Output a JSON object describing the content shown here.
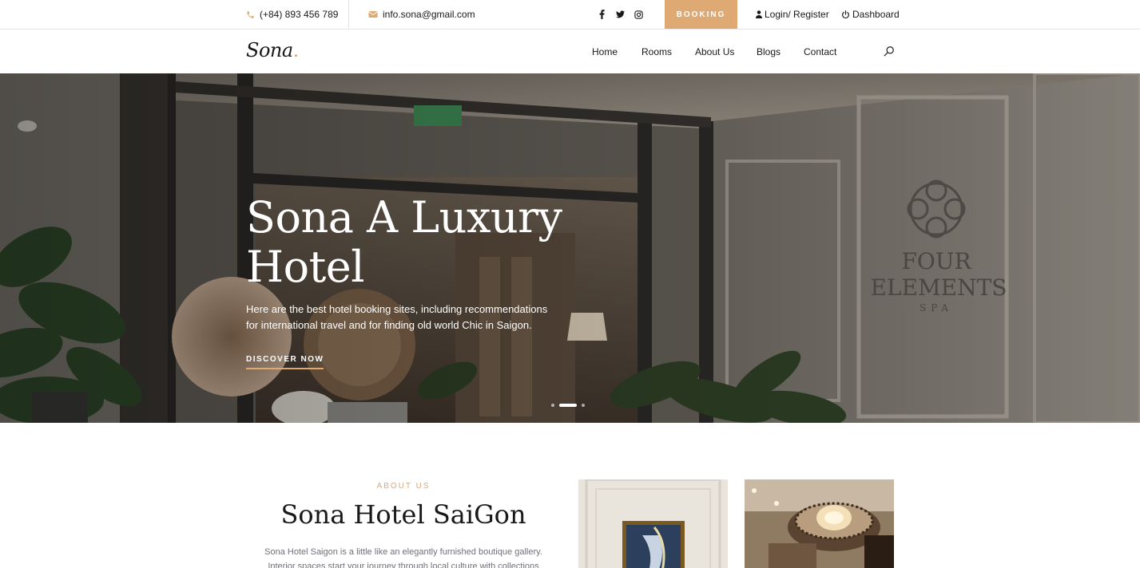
{
  "topbar": {
    "phone": "(+84) 893 456 789",
    "email": "info.sona@gmail.com",
    "social": [
      "facebook-icon",
      "twitter-icon",
      "instagram-icon"
    ],
    "booking_label": "BOOKING",
    "login_label": "Login/ Register",
    "dashboard_label": "Dashboard"
  },
  "nav": {
    "logo_text": "Sona",
    "logo_dot": ".",
    "items": [
      "Home",
      "Rooms",
      "About Us",
      "Blogs",
      "Contact"
    ]
  },
  "hero": {
    "title": "Sona A Luxury Hotel",
    "text": "Here are the best hotel booking sites, including recommendations for international travel and for finding old world Chic in Saigon.",
    "cta": "DISCOVER NOW",
    "sign_line1": "FOUR",
    "sign_line2": "ELEMENTS",
    "sign_line3": "SPA",
    "slide_count": 3,
    "active_slide": 2
  },
  "about": {
    "label": "ABOUT US",
    "title": "Sona Hotel SaiGon",
    "text": "Sona Hotel Saigon is a little like an elegantly furnished boutique gallery. Interior spaces start your journey through local culture with collections"
  },
  "colors": {
    "accent": "#dfa974",
    "dark": "#19191a",
    "muted": "#707079"
  }
}
